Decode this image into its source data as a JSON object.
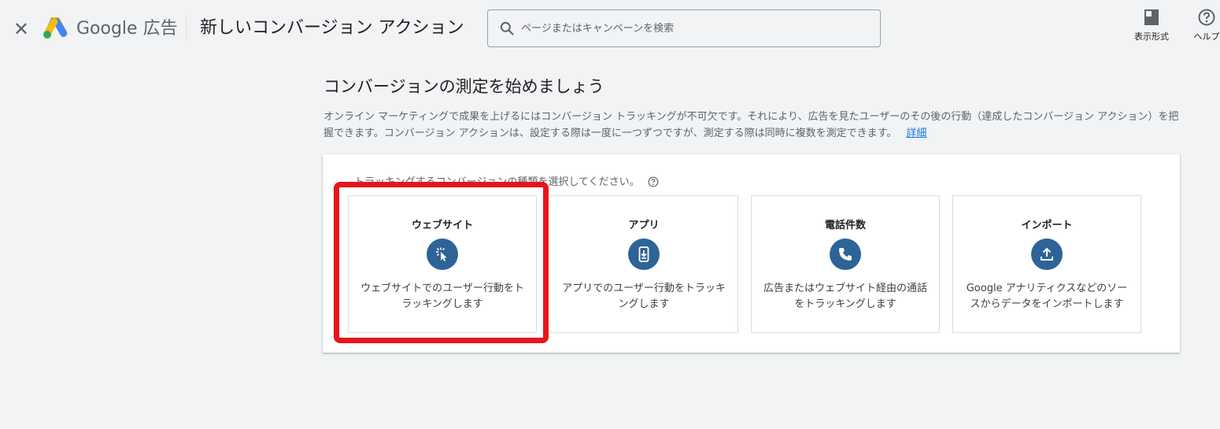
{
  "header": {
    "close_icon": "close-icon",
    "brand_name": "Google 広告",
    "page_heading": "新しいコンバージョン アクション",
    "search": {
      "placeholder": "ページまたはキャンペーンを検索",
      "value": ""
    },
    "tools": [
      {
        "label": "表示形式",
        "icon": "view-layout-icon"
      },
      {
        "label": "ヘルプ",
        "icon": "help-icon"
      }
    ]
  },
  "main": {
    "title": "コンバージョンの測定を始めましょう",
    "intro": "オンライン マーケティングで成果を上げるにはコンバージョン トラッキングが不可欠です。それにより、広告を見たユーザーのその後の行動（達成したコンバージョン アクション）を把握できます。コンバージョン アクションは、設定する際は一度に一つずつですが、測定する際は同時に複数を測定できます。",
    "intro_link": "詳細",
    "prompt": "トラッキングするコンバージョンの種類を選択してください。",
    "cards": [
      {
        "title": "ウェブサイト",
        "icon": "cursor-click-icon",
        "description": "ウェブサイトでのユーザー行動をトラッキングします",
        "highlighted": true
      },
      {
        "title": "アプリ",
        "icon": "mobile-download-icon",
        "description": "アプリでのユーザー行動をトラッキングします"
      },
      {
        "title": "電話件数",
        "icon": "phone-icon",
        "description": "広告またはウェブサイト経由の通話をトラッキングします"
      },
      {
        "title": "インポート",
        "icon": "upload-icon",
        "description": "Google アナリティクスなどのソースからデータをインポートします"
      }
    ]
  },
  "colors": {
    "icon_bg": "#2d6397",
    "highlight": "#e8141a",
    "link": "#1a73e8"
  }
}
